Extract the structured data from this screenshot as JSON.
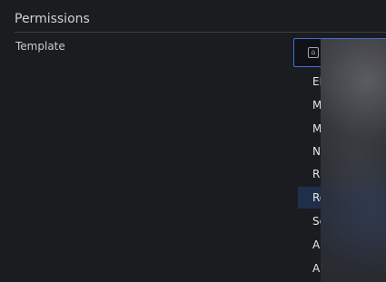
{
  "section": {
    "title": "Permissions"
  },
  "fields": {
    "template_label": "Template"
  },
  "dropdown": {
    "items": [
      "El",
      "M",
      "M",
      "N",
      "R",
      "Ro",
      "Sc",
      "Al",
      "Al"
    ],
    "active_index": 5
  },
  "colors": {
    "accent": "#3d71d9",
    "active_bg": "#1f2f4b"
  },
  "icons": {
    "select_icon": "template-icon"
  }
}
